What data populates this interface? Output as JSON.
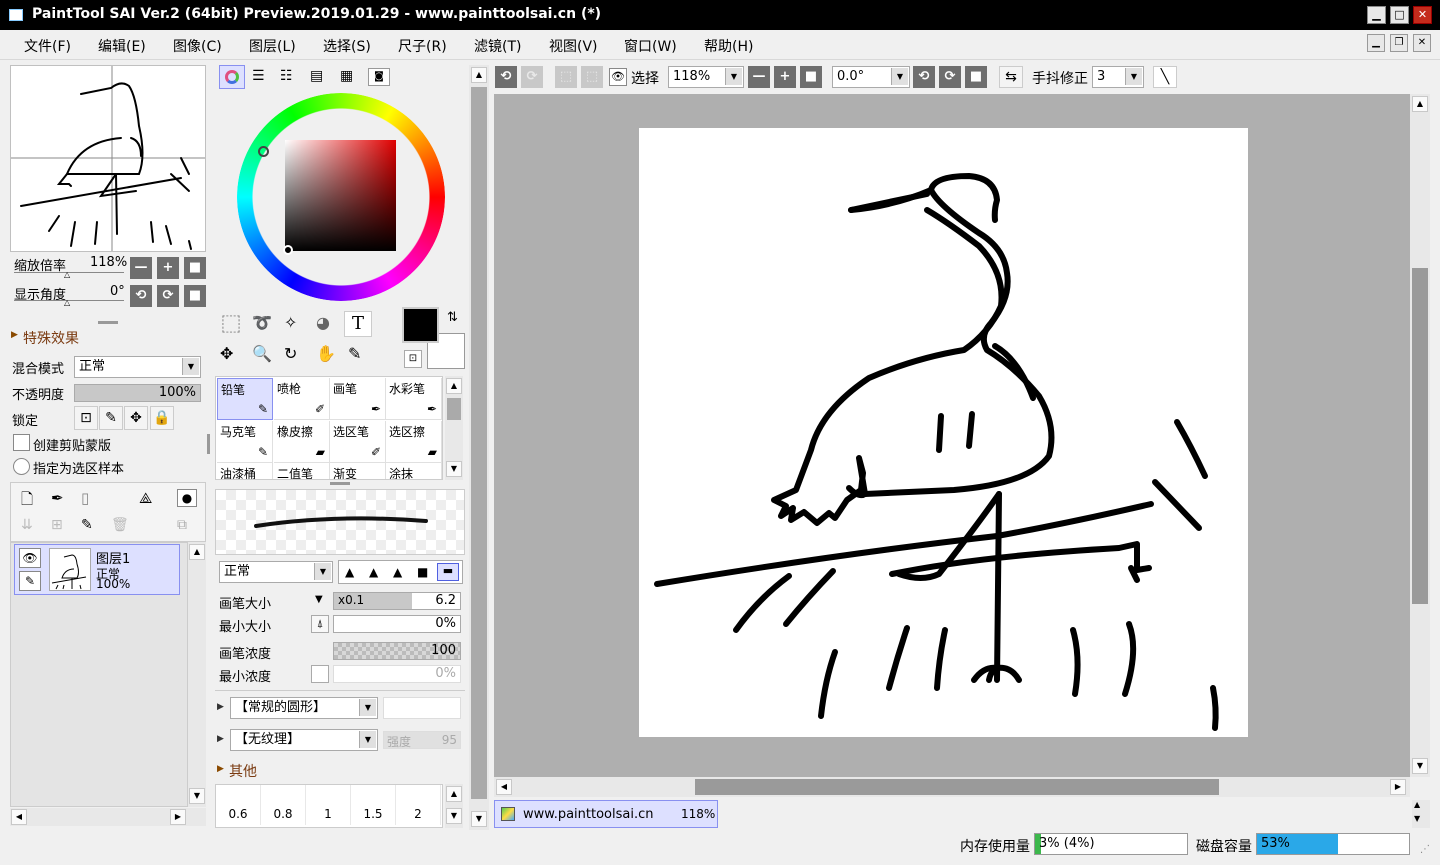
{
  "window": {
    "title": "PaintTool SAI Ver.2 (64bit) Preview.2019.01.29 - www.painttoolsai.cn (*)",
    "btn_min": "▁",
    "btn_max": "□",
    "btn_close": "✕"
  },
  "menu": [
    {
      "label": "文件(F)"
    },
    {
      "label": "编辑(E)"
    },
    {
      "label": "图像(C)"
    },
    {
      "label": "图层(L)"
    },
    {
      "label": "选择(S)"
    },
    {
      "label": "尺子(R)"
    },
    {
      "label": "滤镜(T)"
    },
    {
      "label": "视图(V)"
    },
    {
      "label": "窗口(W)"
    },
    {
      "label": "帮助(H)"
    }
  ],
  "navigator": {
    "zoom_label": "缩放倍率",
    "zoom_value": "118%",
    "angle_label": "显示角度",
    "angle_value": "0°",
    "minus": "—",
    "plus": "+",
    "reset": "■",
    "rot_l": "⟲",
    "rot_r": "⟳"
  },
  "layer_props": {
    "effects_label": "特殊效果",
    "blend_label": "混合模式",
    "blend_value": "正常",
    "opacity_label": "不透明度",
    "opacity_value": "100%",
    "lock_label": "锁定",
    "clip_label": "创建剪贴蒙版",
    "sample_label": "指定为选区样本"
  },
  "layer": {
    "name": "图层1",
    "mode": "正常",
    "opacity": "100%"
  },
  "tools": [
    {
      "label": "铅笔",
      "selected": true
    },
    {
      "label": "喷枪"
    },
    {
      "label": "画笔"
    },
    {
      "label": "水彩笔"
    },
    {
      "label": "马克笔"
    },
    {
      "label": "橡皮擦"
    },
    {
      "label": "选区笔"
    },
    {
      "label": "选区擦"
    },
    {
      "label": "油漆桶"
    },
    {
      "label": "二值笔"
    },
    {
      "label": "渐变"
    },
    {
      "label": "涂抹"
    }
  ],
  "brush": {
    "mode": "正常",
    "size_label": "画笔大小",
    "size_mult": "x0.1",
    "size_value": "6.2",
    "min_size_label": "最小大小",
    "min_size_value": "0%",
    "density_label": "画笔浓度",
    "density_value": "100",
    "min_density_label": "最小浓度",
    "min_density_value": "0%",
    "shape": "【常规的圆形】",
    "texture": "【无纹理】",
    "strength_label": "强度",
    "strength_value": "95",
    "other_label": "其他",
    "sizes": [
      "0.6",
      "0.8",
      "1",
      "1.5",
      "2"
    ]
  },
  "canvas_toolbar": {
    "select_label": "选择",
    "zoom": "118%",
    "angle": "0.0°",
    "stabilizer_label": "手抖修正",
    "stabilizer": "3"
  },
  "canvas_tab": {
    "name": "www.painttoolsai.cn",
    "zoom": "118%"
  },
  "status": {
    "mem_label": "内存使用量",
    "mem_value": "3% (4%)",
    "mem_fraction": 0.04,
    "disk_label": "磁盘容量",
    "disk_value": "53%",
    "disk_fraction": 0.53
  },
  "colors": {
    "foreground": "#000000",
    "background": "#ffffff",
    "accent": "#2aa8e8"
  }
}
